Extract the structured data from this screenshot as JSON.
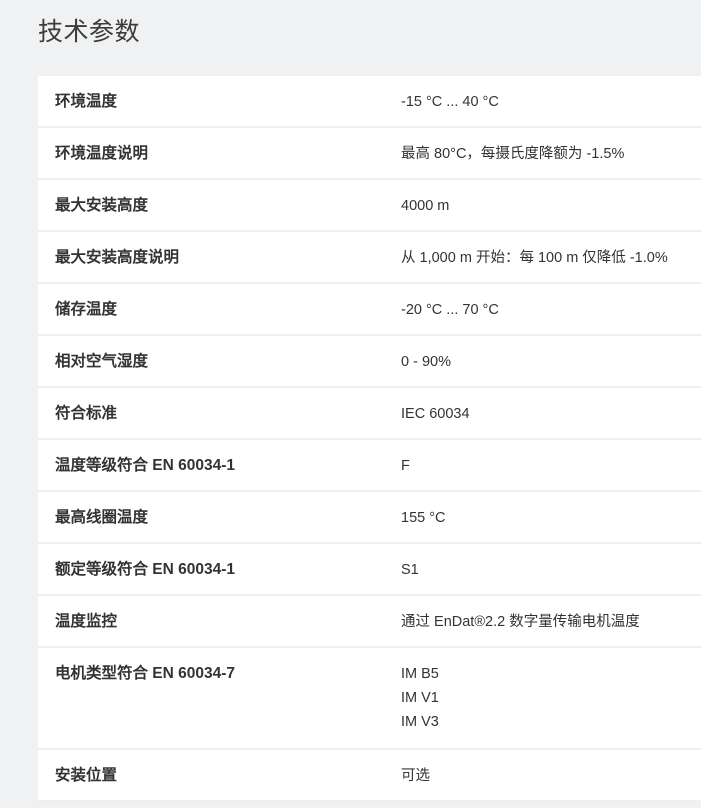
{
  "page": {
    "title": "技术参数"
  },
  "specs": [
    {
      "label": "环境温度",
      "value": "-15 °C ... 40 °C"
    },
    {
      "label": "环境温度说明",
      "value": "最高 80°C，每摄氏度降额为 -1.5%"
    },
    {
      "label": "最大安装高度",
      "value": "4000 m"
    },
    {
      "label": "最大安装高度说明",
      "value": "从 1,000 m 开始：每 100 m 仅降低 -1.0%"
    },
    {
      "label": "储存温度",
      "value": "-20 °C ... 70 °C"
    },
    {
      "label": "相对空气湿度",
      "value": "0 - 90%"
    },
    {
      "label": "符合标准",
      "value": "IEC 60034"
    },
    {
      "label": "温度等级符合 EN 60034-1",
      "value": "F"
    },
    {
      "label": "最高线圈温度",
      "value": "155 °C"
    },
    {
      "label": "额定等级符合 EN 60034-1",
      "value": "S1"
    },
    {
      "label": "温度监控",
      "value": "通过 EnDat®2.2 数字量传输电机温度"
    },
    {
      "label": "电机类型符合 EN 60034-7",
      "values": [
        "IM B5",
        "IM V1",
        "IM V3"
      ]
    },
    {
      "label": "安装位置",
      "value": "可选"
    }
  ]
}
